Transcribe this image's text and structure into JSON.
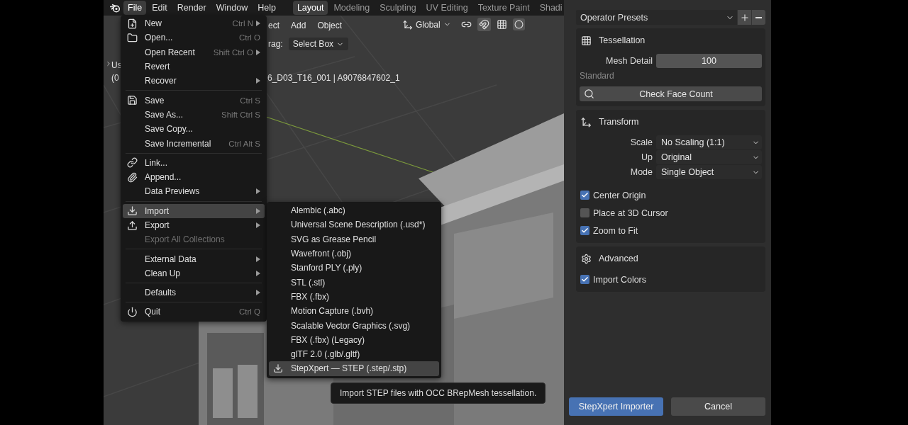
{
  "topbar": {
    "menus": [
      {
        "label": "File",
        "selected": true
      },
      {
        "label": "Edit",
        "selected": false
      },
      {
        "label": "Render",
        "selected": false
      },
      {
        "label": "Window",
        "selected": false
      },
      {
        "label": "Help",
        "selected": false
      }
    ],
    "workspaces": [
      {
        "label": "Layout",
        "selected": true
      },
      {
        "label": "Modeling",
        "selected": false
      },
      {
        "label": "Sculpting",
        "selected": false
      },
      {
        "label": "UV Editing",
        "selected": false
      },
      {
        "label": "Texture Paint",
        "selected": false
      },
      {
        "label": "Shadi",
        "selected": false
      }
    ]
  },
  "viewport_header": {
    "menus": [
      "ect",
      "Add",
      "Object"
    ],
    "orientation": "Global",
    "drag_label": "rag:",
    "drag_value": "Select Box"
  },
  "viewport": {
    "overlay_lines": [
      "Us",
      "(0"
    ],
    "object_path": "6_D03_T16_001 | A9076847602_1"
  },
  "file_menu": {
    "groups": [
      {
        "items": [
          {
            "label": "New",
            "shortcut": "Ctrl N",
            "submenu": true,
            "disabled": false,
            "selected": false
          },
          {
            "label": "Open...",
            "shortcut": "Ctrl O",
            "submenu": false,
            "disabled": false,
            "selected": false
          },
          {
            "label": "Open Recent",
            "shortcut": "Shift Ctrl O",
            "submenu": true,
            "disabled": false,
            "selected": false
          },
          {
            "label": "Revert",
            "submenu": false,
            "disabled": false,
            "selected": false
          },
          {
            "label": "Recover",
            "submenu": true,
            "disabled": false,
            "selected": false
          }
        ]
      },
      {
        "items": [
          {
            "label": "Save",
            "shortcut": "Ctrl S",
            "submenu": false,
            "disabled": false,
            "selected": false
          },
          {
            "label": "Save As...",
            "shortcut": "Shift Ctrl S",
            "submenu": false,
            "disabled": false,
            "selected": false
          },
          {
            "label": "Save Copy...",
            "submenu": false,
            "disabled": false,
            "selected": false
          },
          {
            "label": "Save Incremental",
            "shortcut": "Ctrl Alt S",
            "submenu": false,
            "disabled": false,
            "selected": false
          }
        ]
      },
      {
        "items": [
          {
            "label": "Link...",
            "submenu": false,
            "disabled": false,
            "selected": false
          },
          {
            "label": "Append...",
            "submenu": false,
            "disabled": false,
            "selected": false
          },
          {
            "label": "Data Previews",
            "submenu": true,
            "disabled": false,
            "selected": false
          }
        ]
      },
      {
        "items": [
          {
            "label": "Import",
            "submenu": true,
            "disabled": false,
            "selected": true
          },
          {
            "label": "Export",
            "submenu": true,
            "disabled": false,
            "selected": false
          },
          {
            "label": "Export All Collections",
            "submenu": false,
            "disabled": true,
            "selected": false
          }
        ]
      },
      {
        "items": [
          {
            "label": "External Data",
            "submenu": true,
            "disabled": false,
            "selected": false
          },
          {
            "label": "Clean Up",
            "submenu": true,
            "disabled": false,
            "selected": false
          }
        ]
      },
      {
        "items": [
          {
            "label": "Defaults",
            "submenu": true,
            "disabled": false,
            "selected": false
          }
        ]
      },
      {
        "items": [
          {
            "label": "Quit",
            "shortcut": "Ctrl Q",
            "submenu": false,
            "disabled": false,
            "selected": false
          }
        ]
      }
    ]
  },
  "import_menu": {
    "items": [
      {
        "label": "Alembic (.abc)",
        "selected": false
      },
      {
        "label": "Universal Scene Description (.usd*)",
        "selected": false
      },
      {
        "label": "SVG as Grease Pencil",
        "selected": false
      },
      {
        "label": "Wavefront (.obj)",
        "selected": false
      },
      {
        "label": "Stanford PLY (.ply)",
        "selected": false
      },
      {
        "label": "STL (.stl)",
        "selected": false
      },
      {
        "label": "FBX (.fbx)",
        "selected": false
      },
      {
        "label": "Motion Capture (.bvh)",
        "selected": false
      },
      {
        "label": "Scalable Vector Graphics (.svg)",
        "selected": false
      },
      {
        "label": "FBX (.fbx) (Legacy)",
        "selected": false
      },
      {
        "label": "glTF 2.0 (.glb/.gltf)",
        "selected": false
      },
      {
        "label": "StepXpert — STEP (.step/.stp)",
        "selected": true
      }
    ]
  },
  "tooltip": "Import STEP files with OCC BRepMesh tessellation.",
  "operator_panel": {
    "presets": "Operator Presets",
    "tessellation": {
      "title": "Tessellation",
      "mesh_detail": {
        "label": "Mesh Detail",
        "value": "100"
      },
      "note": "Standard",
      "button": "Check Face Count"
    },
    "transform": {
      "title": "Transform",
      "fields": [
        {
          "label": "Scale",
          "value": "No Scaling (1:1)"
        },
        {
          "label": "Up",
          "value": "Original"
        },
        {
          "label": "Mode",
          "value": "Single Object"
        }
      ],
      "options": [
        {
          "label": "Center Origin",
          "checked": true
        },
        {
          "label": "Place at 3D Cursor",
          "checked": false
        },
        {
          "label": "Zoom to Fit",
          "checked": true
        }
      ]
    },
    "advanced": {
      "title": "Advanced",
      "options": [
        {
          "label": "Import Colors",
          "checked": true
        }
      ]
    },
    "confirm": "StepXpert Importer",
    "cancel": "Cancel"
  }
}
